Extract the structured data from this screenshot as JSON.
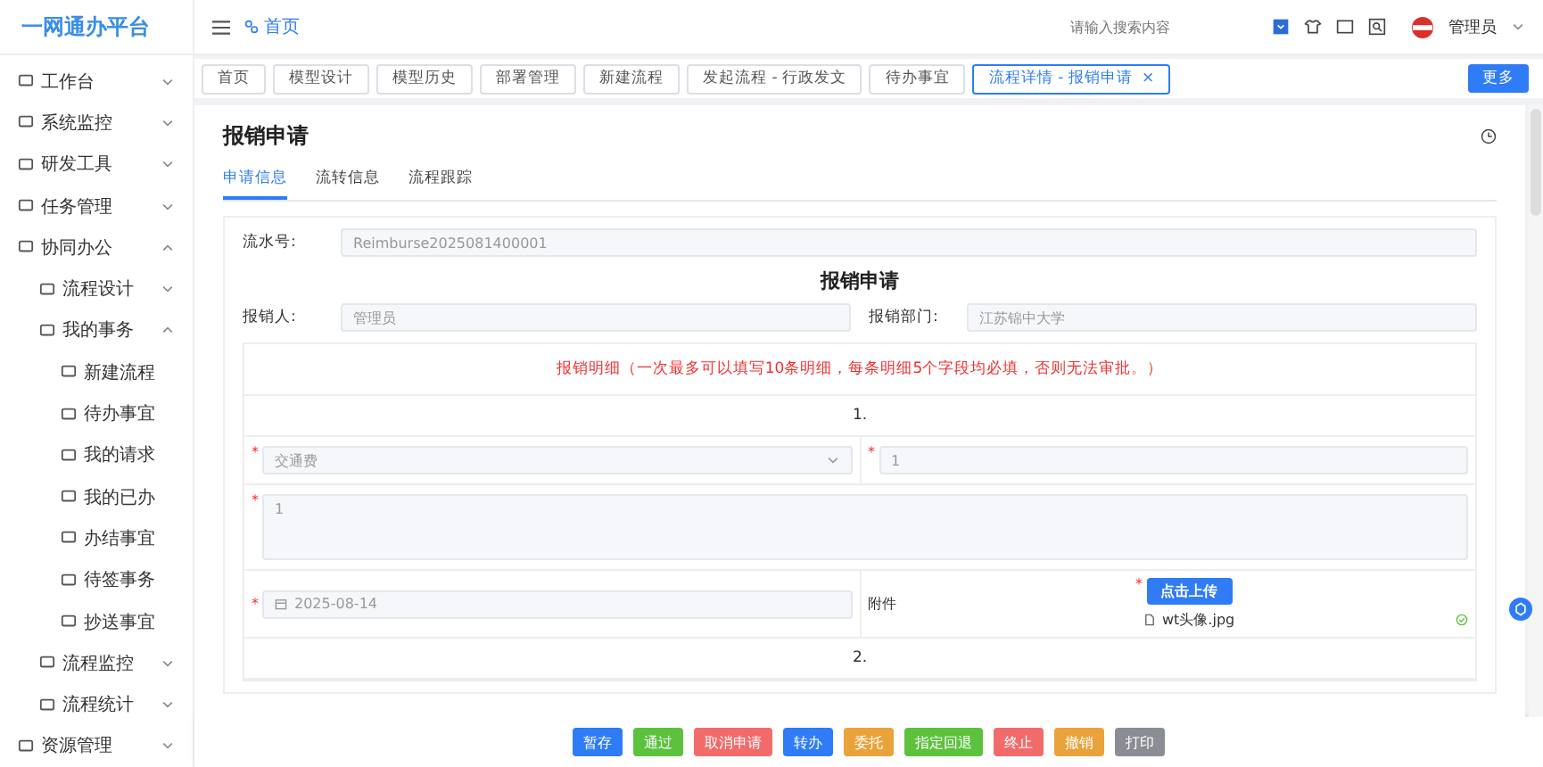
{
  "app": {
    "title": "一网通办平台"
  },
  "header": {
    "breadcrumb": "首页",
    "search": {
      "placeholder": "请输入搜索内容"
    },
    "user": "管理员"
  },
  "sidebar": {
    "items": [
      {
        "label": "工作台",
        "expanded": false
      },
      {
        "label": "系统监控",
        "expanded": false
      },
      {
        "label": "研发工具",
        "expanded": false
      },
      {
        "label": "任务管理",
        "expanded": false
      },
      {
        "label": "协同办公",
        "expanded": true,
        "children": [
          {
            "label": "流程设计",
            "expanded": false
          },
          {
            "label": "我的事务",
            "expanded": true,
            "children": [
              {
                "label": "新建流程"
              },
              {
                "label": "待办事宜"
              },
              {
                "label": "我的请求"
              },
              {
                "label": "我的已办"
              },
              {
                "label": "办结事宜"
              },
              {
                "label": "待签事务"
              },
              {
                "label": "抄送事宜"
              }
            ]
          },
          {
            "label": "流程监控",
            "expanded": false
          },
          {
            "label": "流程统计",
            "expanded": false
          }
        ]
      },
      {
        "label": "资源管理",
        "expanded": false
      }
    ]
  },
  "tabs": [
    {
      "label": "首页",
      "selected": false
    },
    {
      "label": "模型设计",
      "selected": false
    },
    {
      "label": "模型历史",
      "selected": false
    },
    {
      "label": "部署管理",
      "selected": false
    },
    {
      "label": "新建流程",
      "selected": false
    },
    {
      "label": "发起流程 - 行政发文",
      "selected": false
    },
    {
      "label": "待办事宜",
      "selected": false
    },
    {
      "label": "流程详情 - 报销申请",
      "selected": true,
      "close": "×"
    }
  ],
  "more_button": "更多",
  "page": {
    "title": "报销申请",
    "tabs": [
      {
        "label": "申请信息",
        "selected": true
      },
      {
        "label": "流转信息",
        "selected": false
      },
      {
        "label": "流程跟踪",
        "selected": false
      }
    ],
    "serial": {
      "label": "流水号:",
      "value": "Reimburse2025081400001"
    },
    "heading": "报销申请",
    "fields": [
      {
        "label": "报销人:",
        "value": "管理员"
      },
      {
        "label": "报销部门:",
        "value": "江苏锦中大学"
      }
    ],
    "details": {
      "notice": "报销明细（一次最多可以填写10条明细，每条明细5个字段均必填，否则无法审批。）",
      "entries": [
        {
          "number": "1.",
          "type": {
            "value": "交通费",
            "required_mark": "*"
          },
          "amount": {
            "value": "1",
            "required_mark": "*"
          },
          "description": {
            "value": "1",
            "required_mark": "*"
          },
          "date": {
            "value": "2025-08-14",
            "required_mark": "*"
          },
          "attachment": {
            "label": "附件",
            "required_mark": "*",
            "upload_button": "点击上传",
            "files": [
              {
                "name": "wt头像.jpg",
                "uploaded": true
              }
            ]
          }
        },
        {
          "number": "2."
        }
      ]
    }
  },
  "actions": [
    {
      "label": "暂存",
      "color": "#2f7cf6"
    },
    {
      "label": "通过",
      "color": "#5cc23e"
    },
    {
      "label": "取消申请",
      "color": "#f26b6b"
    },
    {
      "label": "转办",
      "color": "#2f7cf6"
    },
    {
      "label": "委托",
      "color": "#eaa23a"
    },
    {
      "label": "指定回退",
      "color": "#5cc23e"
    },
    {
      "label": "终止",
      "color": "#f26b6b"
    },
    {
      "label": "撤销",
      "color": "#eaa23a"
    },
    {
      "label": "打印",
      "color": "#8a8d93"
    }
  ]
}
